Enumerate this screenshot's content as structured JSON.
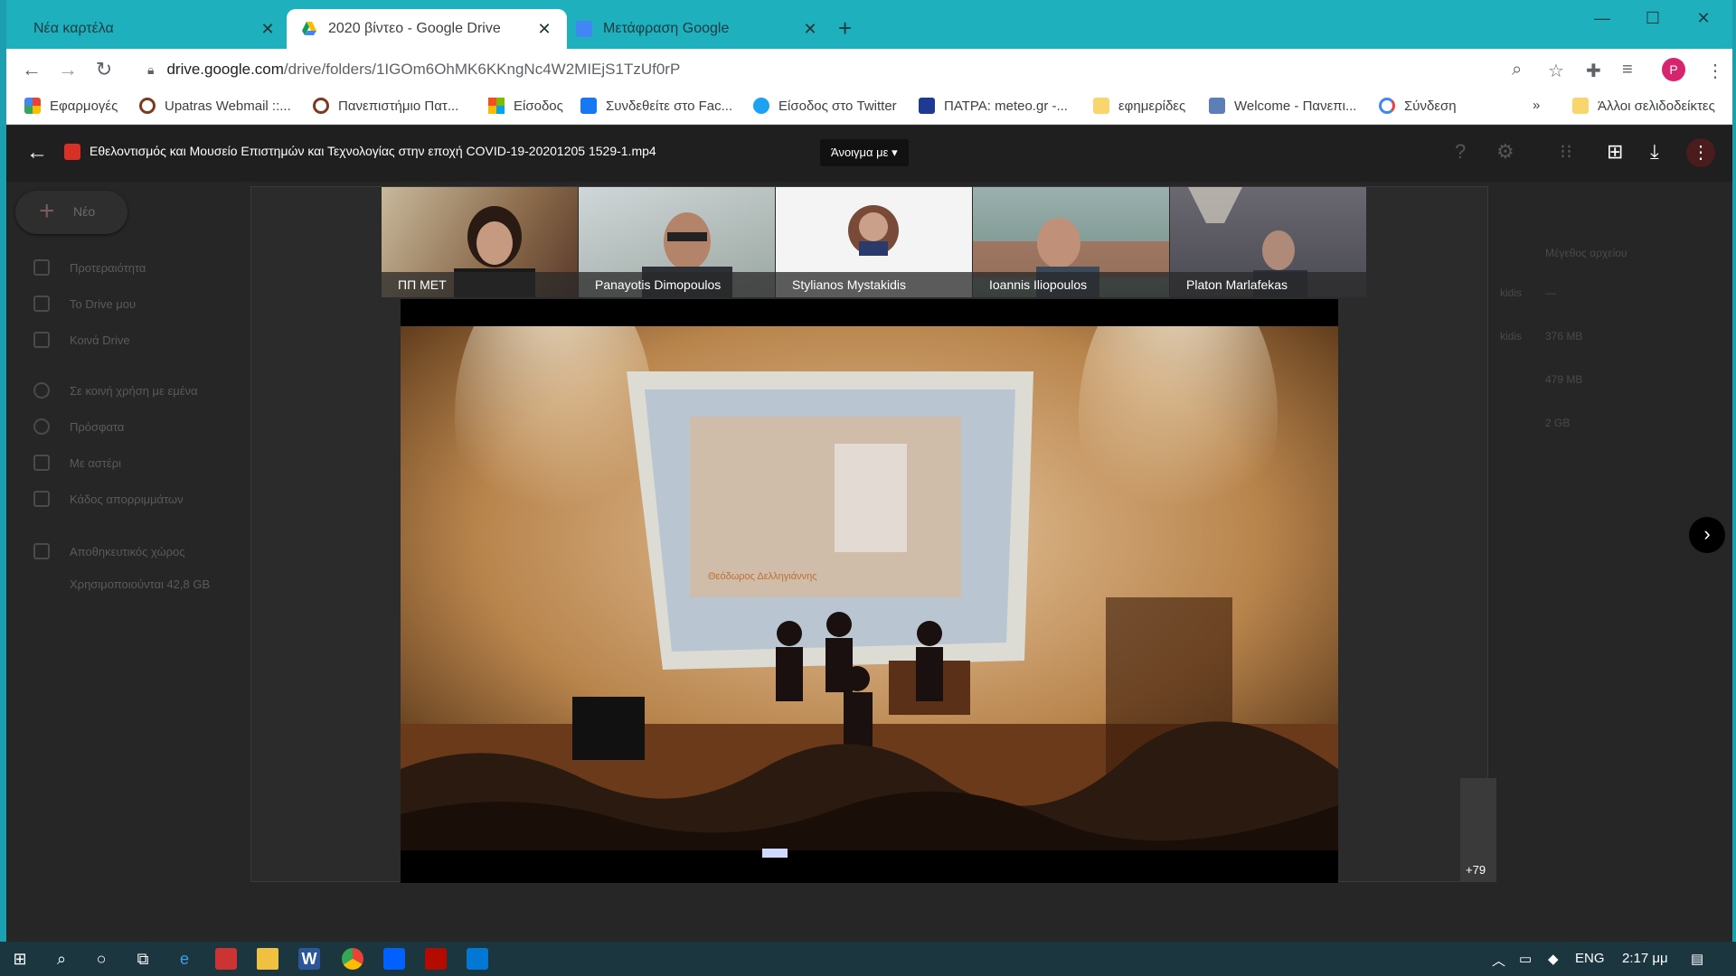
{
  "browser": {
    "tabs": [
      {
        "title": "Νέα καρτέλα",
        "active": false
      },
      {
        "title": "2020 βίντεο - Google Drive",
        "active": true
      },
      {
        "title": "Μετάφραση Google",
        "active": false
      }
    ],
    "new_tab": "+",
    "url_host": "drive.google.com",
    "url_path": "/drive/folders/1IGOm6OhMK6KKngNc4W2MIEjS1TzUf0rP",
    "profile_initial": "P",
    "bookmarks": [
      {
        "label": "Εφαρμογές",
        "icon": "apps-grid-icon",
        "color": "#ea4335"
      },
      {
        "label": "Upatras Webmail ::...",
        "icon": "upatras-icon",
        "color": "#7a3b1e"
      },
      {
        "label": "Πανεπιστήμιο Πατ...",
        "icon": "upatras-icon",
        "color": "#7a3b1e"
      },
      {
        "label": "Είσοδος",
        "icon": "microsoft-icon",
        "color": "#f25022"
      },
      {
        "label": "Συνδεθείτε στο Fac...",
        "icon": "facebook-icon",
        "color": "#1877f2"
      },
      {
        "label": "Είσοδος στο Twitter",
        "icon": "twitter-icon",
        "color": "#1da1f2"
      },
      {
        "label": "ΠΑΤΡΑ: meteo.gr -...",
        "icon": "meteo-icon",
        "color": "#1f3a93"
      },
      {
        "label": "εφημερίδες",
        "icon": "folder-icon",
        "color": "#f9d56e"
      },
      {
        "label": "Welcome - Πανεπι...",
        "icon": "welcome-icon",
        "color": "#5b7fb6"
      },
      {
        "label": "Σύνδεση",
        "icon": "google-icon",
        "color": "#4285f4"
      }
    ],
    "bookmarks_overflow": "»",
    "other_bookmarks": "Άλλοι σελιδοδείκτες"
  },
  "drive": {
    "new_button": "Νέο",
    "sidebar": [
      "Προτεραιότητα",
      "Το Drive μου",
      "Κοινά Drive",
      "Σε κοινή χρήση με εμένα",
      "Πρόσφατα",
      "Με αστέρι",
      "Κάδος απορριμμάτων",
      "Αποθηκευτικός χώρος",
      "Χρησιμοποιούνται 42,8 GB"
    ],
    "col_header": "Μέγεθος αρχείου",
    "rows": [
      {
        "owner": "kidis",
        "size": "—"
      },
      {
        "owner": "kidis",
        "size": "376 MB"
      },
      {
        "owner": "",
        "size": "479 MB"
      },
      {
        "owner": "",
        "size": "2 GB"
      }
    ]
  },
  "preview": {
    "file_name": "Εθελοντισμός και Μουσείο Επιστημών και Τεχνολογίας στην εποχή COVID-19-20201205 1529-1.mp4",
    "open_with": "Άνοιγμα με",
    "participants": [
      "ΠΠ ΜΕΤ",
      "Panayotis Dimopoulos",
      "Stylianos Mystakidis",
      "Ioannis Iliopoulos",
      "Platon Marlafekas"
    ],
    "more_participants": "+79",
    "slide_text": "Θεόδωρος Δελληγιάννης"
  },
  "taskbar": {
    "lang": "ENG",
    "time": "2:17 μμ"
  }
}
